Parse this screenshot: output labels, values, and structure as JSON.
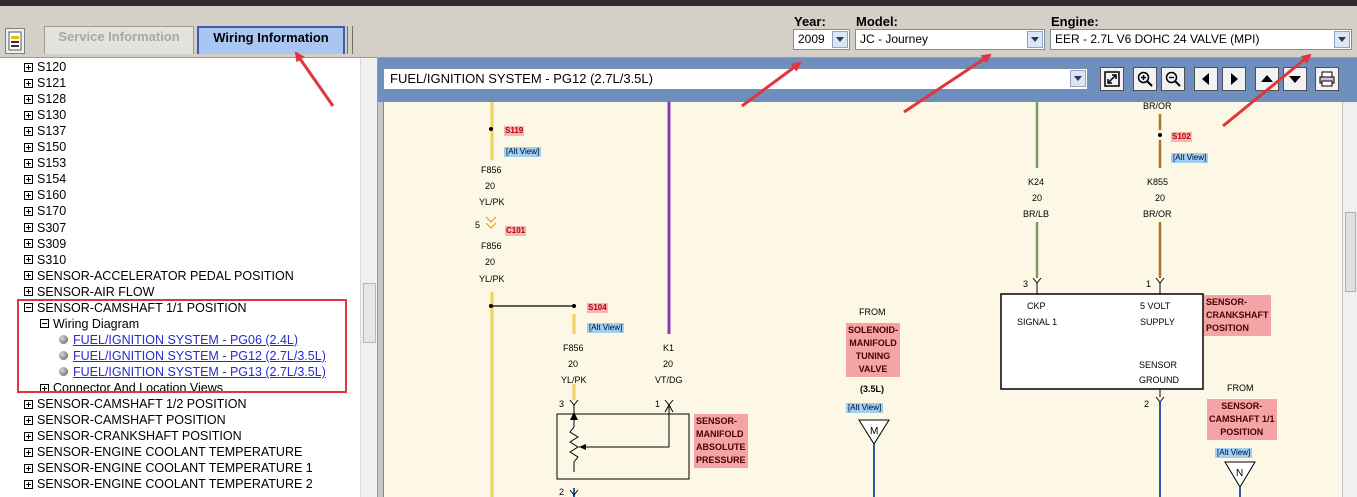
{
  "header": {
    "tabs": {
      "service": "Service Information",
      "wiring": "Wiring Information"
    },
    "year": {
      "label": "Year:",
      "value": "2009"
    },
    "model": {
      "label": "Model:",
      "value": "JC - Journey"
    },
    "engine": {
      "label": "Engine:",
      "value": "EER - 2.7L V6 DOHC 24 VALVE (MPI)"
    }
  },
  "tree": {
    "s_items": [
      "S120",
      "S121",
      "S128",
      "S130",
      "S137",
      "S150",
      "S153",
      "S154",
      "S160",
      "S170",
      "S307",
      "S309",
      "S310"
    ],
    "accel": "SENSOR-ACCELERATOR PEDAL POSITION",
    "airflow": "SENSOR-AIR FLOW",
    "camshaft11": "SENSOR-CAMSHAFT 1/1 POSITION",
    "wiring_diagram": "Wiring Diagram",
    "links": [
      "FUEL/IGNITION SYSTEM - PG06 (2.4L)",
      "FUEL/IGNITION SYSTEM - PG12 (2.7L/3.5L)",
      "FUEL/IGNITION SYSTEM - PG13 (2.7L/3.5L)"
    ],
    "connector": "Connector And Location Views",
    "after": [
      "SENSOR-CAMSHAFT 1/2 POSITION",
      "SENSOR-CAMSHAFT POSITION",
      "SENSOR-CRANKSHAFT POSITION",
      "SENSOR-ENGINE COOLANT TEMPERATURE",
      "SENSOR-ENGINE COOLANT TEMPERATURE 1",
      "SENSOR-ENGINE COOLANT TEMPERATURE 2"
    ]
  },
  "toolbar": {
    "page": "FUEL/IGNITION SYSTEM - PG12 (2.7L/3.5L)",
    "buttons": [
      "fit-icon",
      "zoom-in-icon",
      "zoom-out-icon",
      "arrow-left-icon",
      "arrow-right-icon",
      "arrow-up-icon",
      "arrow-down-icon",
      "print-icon"
    ]
  },
  "diagram": {
    "s119": "S119",
    "alt": "[Alt View]",
    "f856": "F856",
    "g20": "20",
    "ylpk": "YL/PK",
    "pin5": "5",
    "c101": "C101",
    "s104": "S104",
    "k1": "K1",
    "vtdg": "VT/DG",
    "pin3": "3",
    "pin1": "1",
    "pin2": "2",
    "map_label": [
      "SENSOR-",
      "MANIFOLD",
      "ABSOLUTE",
      "PRESSURE"
    ],
    "from": "FROM",
    "solenoid": [
      "SOLENOID-",
      "MANIFOLD",
      "TUNING",
      "VALVE"
    ],
    "v35": "(3.5L)",
    "m": "M",
    "n": "N",
    "k24": "K24",
    "brlb": "BR/LB",
    "bror": "BR/OR",
    "s102": "S102",
    "k855": "K855",
    "ckp": "CKP",
    "signal1": "SIGNAL 1",
    "volt5": "5 VOLT",
    "supply": "SUPPLY",
    "sensor": "SENSOR",
    "ground": "GROUND",
    "crank_label": [
      "SENSOR-",
      "CRANKSHAFT",
      "POSITION"
    ],
    "cam11": [
      "SENSOR-",
      "CAMSHAFT 1/1",
      "POSITION"
    ]
  },
  "colors": {
    "accent": "#6e8fbe",
    "annotation": "#e0353a",
    "yellow_wire": "#f0d060",
    "violet_wire": "#8a3ab0",
    "green_wire": "#7a9a6a",
    "brown_wire": "#a8742c",
    "blue_wire": "#2a5ab0"
  }
}
